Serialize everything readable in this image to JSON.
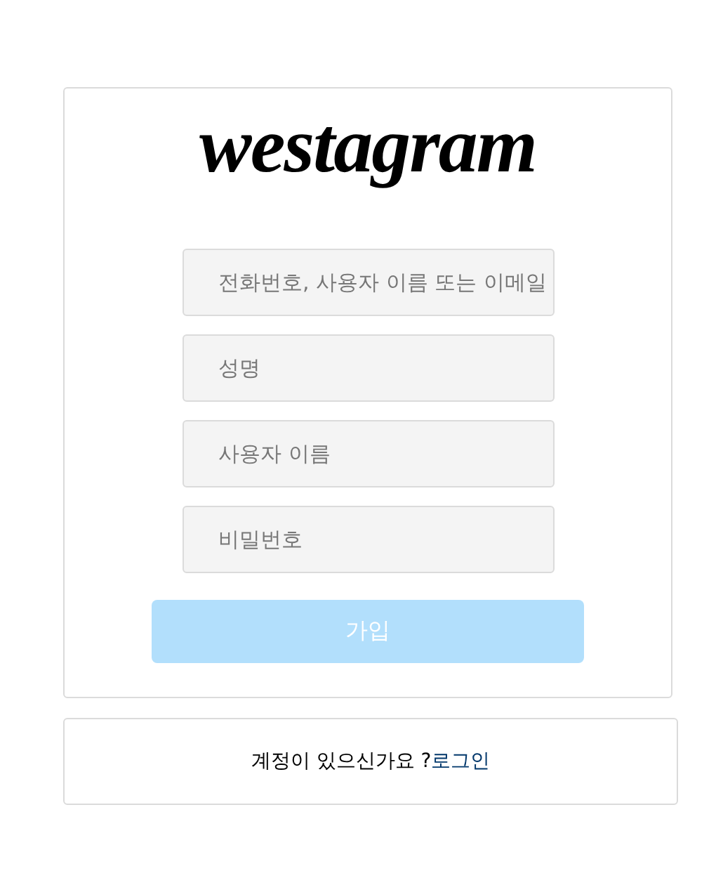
{
  "logo": "westagram",
  "fields": [
    {
      "placeholder": "전화번호, 사용자 이름 또는 이메일"
    },
    {
      "placeholder": "성명"
    },
    {
      "placeholder": "사용자 이름"
    },
    {
      "placeholder": "비밀번호"
    }
  ],
  "submit": {
    "label": "가입",
    "disabled": true
  },
  "login_prompt": {
    "text": "계정이 있으신가요 ?",
    "link": "로그인"
  }
}
